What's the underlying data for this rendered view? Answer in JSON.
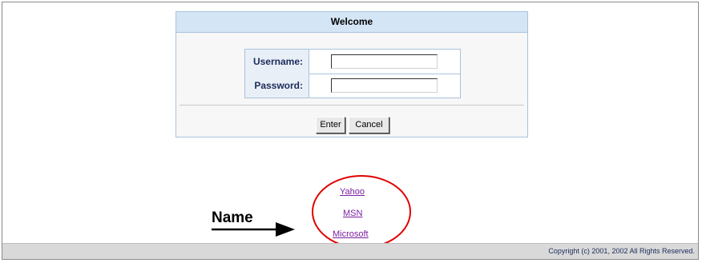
{
  "login": {
    "title": "Welcome",
    "username_label": "Username:",
    "username_value": "",
    "password_label": "Password:",
    "password_value": "",
    "enter_label": "Enter",
    "cancel_label": "Cancel"
  },
  "links": {
    "yahoo": "Yahoo",
    "msn": "MSN",
    "microsoft": "Microsoft"
  },
  "annotation": {
    "label": "Name"
  },
  "footer": {
    "copyright": "Copyright (c) 2001, 2002 All Rights Reserved."
  },
  "colors": {
    "header_bg": "#d4e5f5",
    "panel_border": "#a9c3dd",
    "link": "#7a1fa0",
    "callout": "#e00000"
  }
}
